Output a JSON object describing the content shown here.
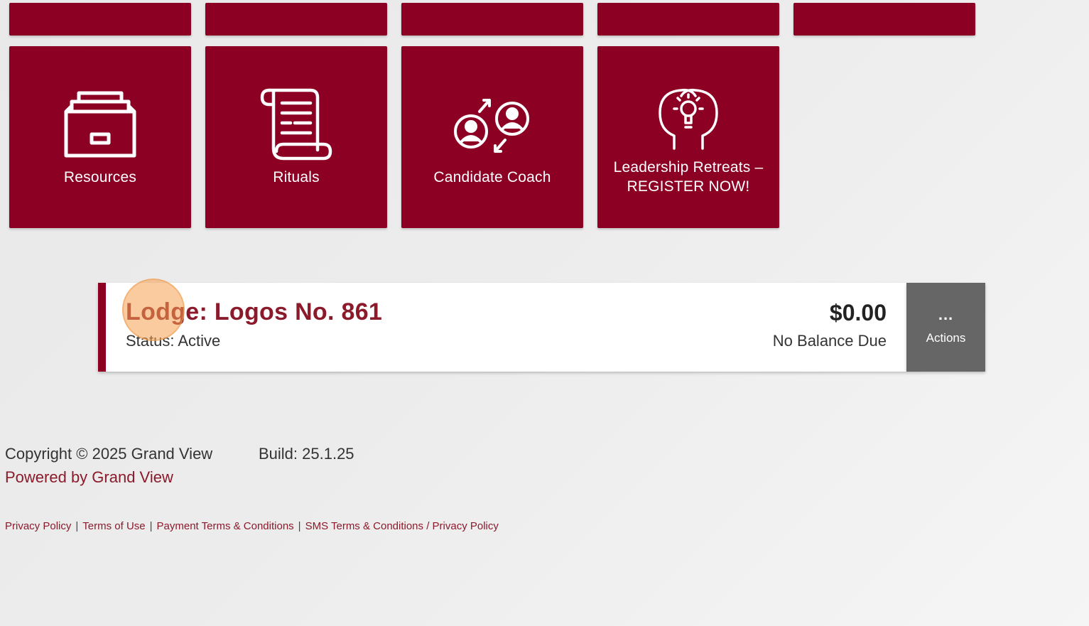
{
  "tiles": [
    {
      "label": "Resources",
      "icon": "file-cabinet-icon"
    },
    {
      "label": "Rituals",
      "icon": "scroll-icon"
    },
    {
      "label": "Candidate Coach",
      "icon": "mentor-exchange-icon"
    },
    {
      "label": "Leadership Retreats –\nREGISTER NOW!",
      "label_line1": "Leadership Retreats –",
      "label_line2": "REGISTER NOW!",
      "icon": "head-lightbulb-icon"
    }
  ],
  "lodge": {
    "title": "Lodge: Logos No. 861",
    "status": "Status: Active",
    "amount": "$0.00",
    "balance": "No Balance Due",
    "actions_dots": "...",
    "actions_label": "Actions"
  },
  "footer": {
    "copyright": "Copyright © 2025 Grand View",
    "build": "Build: 25.1.25",
    "powered": "Powered by Grand View",
    "links": [
      "Privacy Policy",
      "Terms of Use",
      "Payment Terms & Conditions",
      "SMS Terms & Conditions / Privacy Policy"
    ],
    "separator": "|"
  },
  "colors": {
    "accent": "#8b0023",
    "title": "#8b1a2b",
    "actions": "#666666"
  }
}
